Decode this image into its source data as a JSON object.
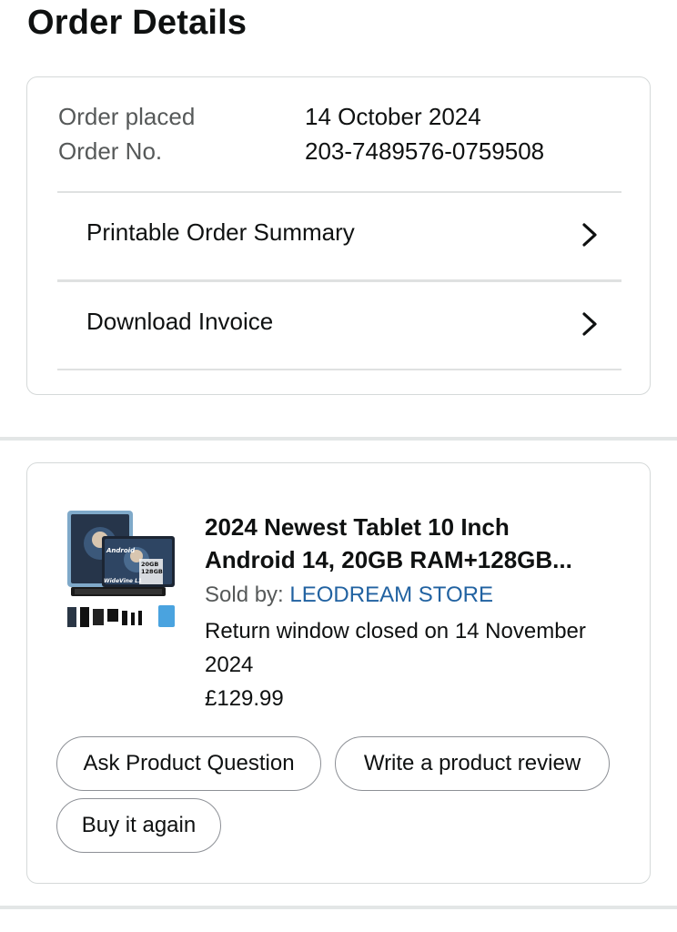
{
  "page": {
    "title": "Order Details"
  },
  "order": {
    "placed_label": "Order placed",
    "placed_value": "14 October 2024",
    "number_label": "Order No.",
    "number_value": "203-7489576-0759508",
    "links": [
      {
        "label": "Printable Order Summary",
        "icon": "chevron-right-icon"
      },
      {
        "label": "Download Invoice",
        "icon": "chevron-right-icon"
      }
    ]
  },
  "item": {
    "title_line1": "2024 Newest Tablet 10 Inch",
    "title_line2": "Android 14, 20GB RAM+128GB...",
    "sold_by_label": "Sold by: ",
    "seller": "LEODREAM STORE",
    "return_text": "Return window closed on 14 November 2024",
    "price": "£129.99",
    "image_text": {
      "os": "Android",
      "ram": "20GB",
      "storage": "128GB",
      "drm": "WideVine L1"
    },
    "actions": {
      "ask": "Ask Product Question",
      "review": "Write a product review",
      "buy_again": "Buy it again"
    }
  },
  "colors": {
    "seller_link": "#2162a1",
    "muted": "#565959",
    "border": "#d5d9d9",
    "text": "#0f1111"
  }
}
